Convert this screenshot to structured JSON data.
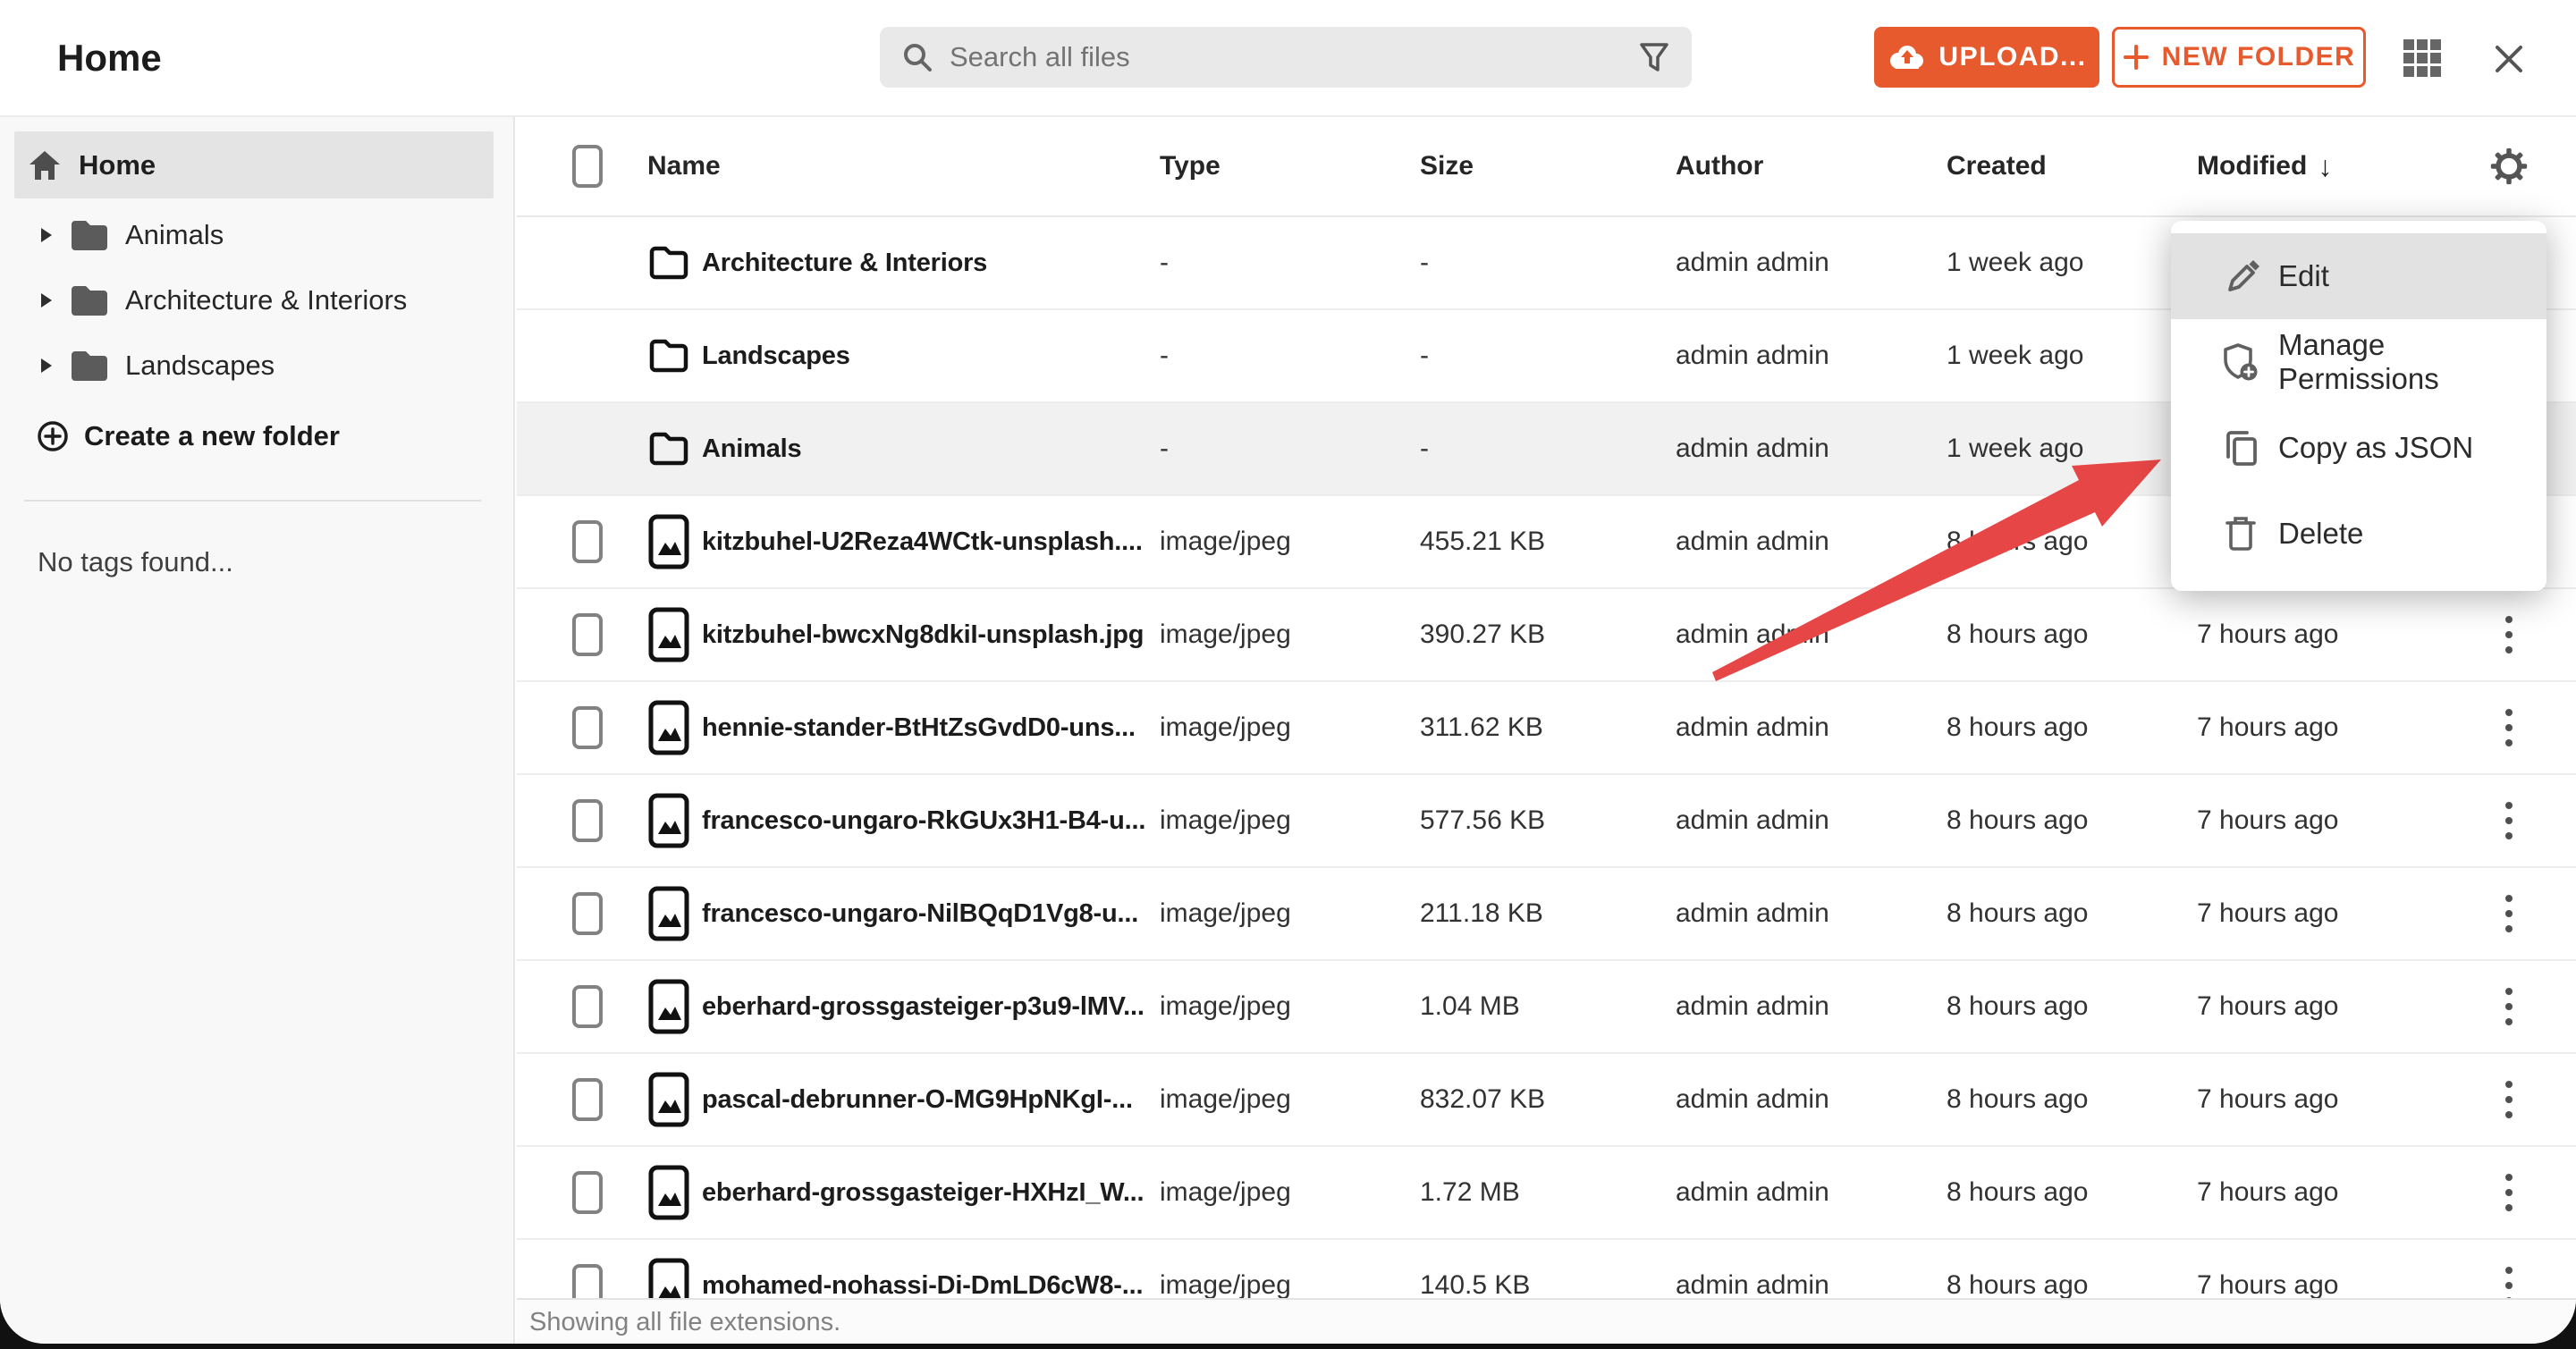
{
  "page": {
    "title": "Home"
  },
  "colors": {
    "accent_orange": "#e65a2e",
    "arrow_red": "#e64646",
    "selected_row_gray": "#f1f1f1",
    "menu_highlight_gray": "#e2e2e2",
    "page_background": "#111111"
  },
  "topbar": {
    "title": "Home",
    "search_placeholder": "Search all files",
    "upload_button": "UPLOAD...",
    "new_folder_button": "NEW FOLDER"
  },
  "sidebar": {
    "home": "Home",
    "folders": [
      "Animals",
      "Architecture & Interiors",
      "Landscapes"
    ],
    "create_folder": "Create a new folder",
    "tags_empty": "No tags found..."
  },
  "table": {
    "headers": {
      "name": "Name",
      "type": "Type",
      "size": "Size",
      "author": "Author",
      "created": "Created",
      "modified": "Modified"
    },
    "sort": {
      "column": "Modified",
      "direction": "desc",
      "arrow": "↓"
    },
    "rows": [
      {
        "kind": "folder",
        "selected": false,
        "name": "Architecture & Interiors",
        "type": "-",
        "size": "-",
        "author": "admin admin",
        "created": "1 week ago",
        "modified": ""
      },
      {
        "kind": "folder",
        "selected": false,
        "name": "Landscapes",
        "type": "-",
        "size": "-",
        "author": "admin admin",
        "created": "1 week ago",
        "modified": ""
      },
      {
        "kind": "folder",
        "selected": true,
        "name": "Animals",
        "type": "-",
        "size": "-",
        "author": "admin admin",
        "created": "1 week ago",
        "modified": ""
      },
      {
        "kind": "image",
        "selected": false,
        "name": "kitzbuhel-U2Reza4WCtk-unsplash....",
        "type": "image/jpeg",
        "size": "455.21 KB",
        "author": "admin admin",
        "created": "8 hours ago",
        "modified": ""
      },
      {
        "kind": "image",
        "selected": false,
        "name": "kitzbuhel-bwcxNg8dkiI-unsplash.jpg",
        "type": "image/jpeg",
        "size": "390.27 KB",
        "author": "admin admin",
        "created": "8 hours ago",
        "modified": "7 hours ago"
      },
      {
        "kind": "image",
        "selected": false,
        "name": "hennie-stander-BtHtZsGvdD0-uns...",
        "type": "image/jpeg",
        "size": "311.62 KB",
        "author": "admin admin",
        "created": "8 hours ago",
        "modified": "7 hours ago"
      },
      {
        "kind": "image",
        "selected": false,
        "name": "francesco-ungaro-RkGUx3H1-B4-u...",
        "type": "image/jpeg",
        "size": "577.56 KB",
        "author": "admin admin",
        "created": "8 hours ago",
        "modified": "7 hours ago"
      },
      {
        "kind": "image",
        "selected": false,
        "name": "francesco-ungaro-NilBQqD1Vg8-u...",
        "type": "image/jpeg",
        "size": "211.18 KB",
        "author": "admin admin",
        "created": "8 hours ago",
        "modified": "7 hours ago"
      },
      {
        "kind": "image",
        "selected": false,
        "name": "eberhard-grossgasteiger-p3u9-lMV...",
        "type": "image/jpeg",
        "size": "1.04 MB",
        "author": "admin admin",
        "created": "8 hours ago",
        "modified": "7 hours ago"
      },
      {
        "kind": "image",
        "selected": false,
        "name": "pascal-debrunner-O-MG9HpNKgI-...",
        "type": "image/jpeg",
        "size": "832.07 KB",
        "author": "admin admin",
        "created": "8 hours ago",
        "modified": "7 hours ago"
      },
      {
        "kind": "image",
        "selected": false,
        "name": "eberhard-grossgasteiger-HXHzI_W...",
        "type": "image/jpeg",
        "size": "1.72 MB",
        "author": "admin admin",
        "created": "8 hours ago",
        "modified": "7 hours ago"
      },
      {
        "kind": "image",
        "selected": false,
        "name": "mohamed-nohassi-Di-DmLD6cW8-...",
        "type": "image/jpeg",
        "size": "140.5 KB",
        "author": "admin admin",
        "created": "8 hours ago",
        "modified": "7 hours ago"
      }
    ]
  },
  "context_menu": {
    "items": [
      {
        "label": "Edit",
        "icon": "pencil-icon",
        "highlighted": true
      },
      {
        "label": "Manage Permissions",
        "icon": "shield-plus-icon",
        "highlighted": false
      },
      {
        "label": "Copy as JSON",
        "icon": "copy-icon",
        "highlighted": false
      },
      {
        "label": "Delete",
        "icon": "trash-icon",
        "highlighted": false
      }
    ]
  },
  "annotation": {
    "type": "red-arrow",
    "points_at": "Copy as JSON"
  },
  "footer": {
    "status": "Showing all file extensions."
  }
}
